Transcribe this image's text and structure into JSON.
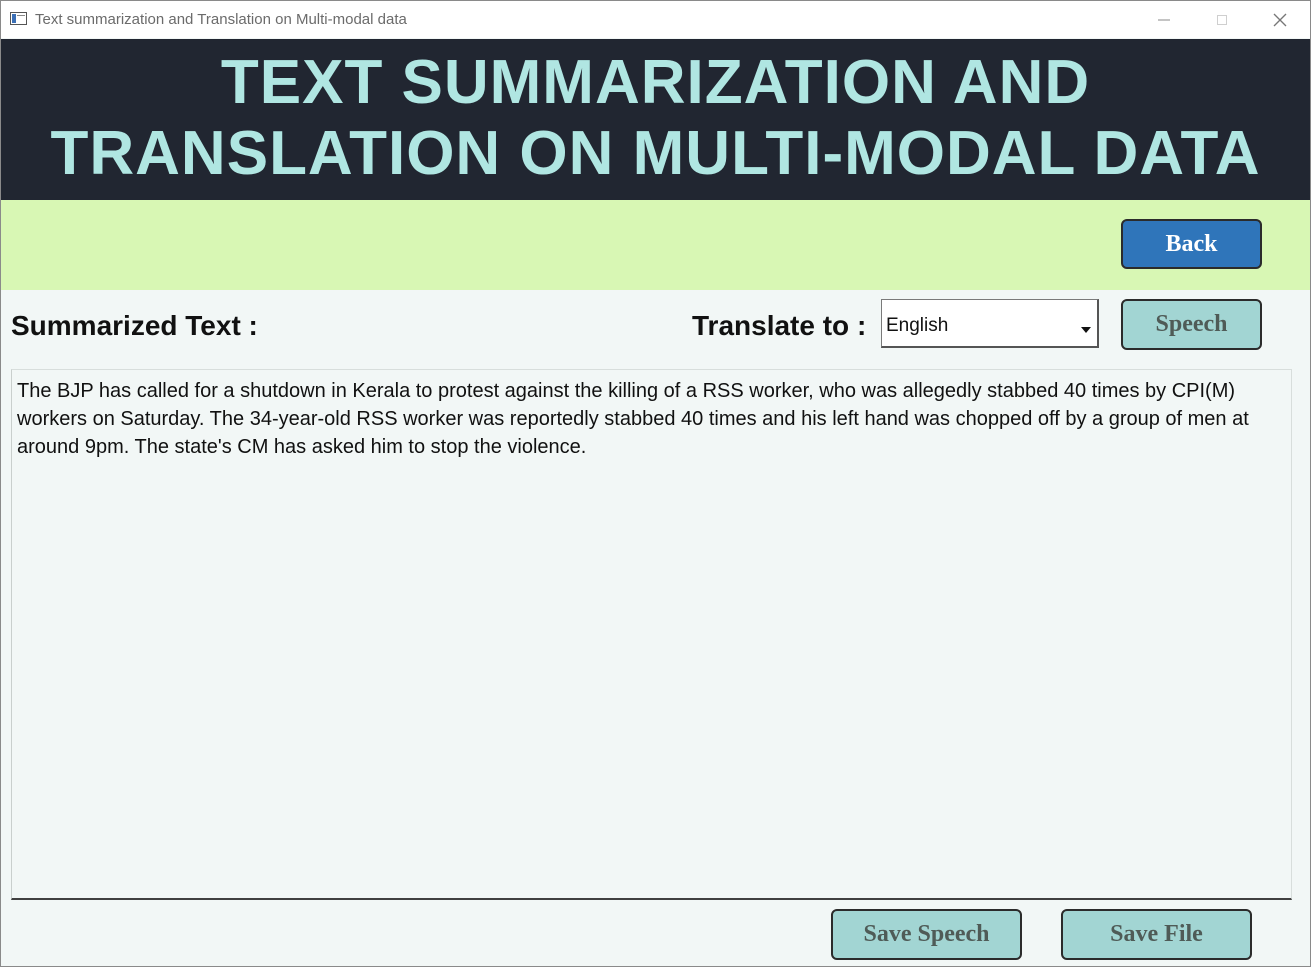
{
  "window": {
    "title": "Text summarization and Translation on Multi-modal data",
    "controls": [
      "minimize-icon",
      "maximize-icon",
      "close-icon"
    ]
  },
  "banner": {
    "line1": "TEXT SUMMARIZATION AND",
    "line2": "TRANSLATION ON MULTI-MODAL DATA"
  },
  "toolbar": {
    "back_label": "Back"
  },
  "main": {
    "summarized_label": "Summarized Text :",
    "translate_label": "Translate to :",
    "language_selected": "English",
    "speech_label": "Speech",
    "summary_text": "The BJP has called for a shutdown in Kerala to protest against the killing of a RSS worker, who was allegedly stabbed 40 times by CPI(M) workers on Saturday. The 34-year-old RSS worker was reportedly stabbed 40 times and his left hand was chopped off by a group of men at around 9pm. The state's CM has asked him to stop the violence."
  },
  "footer": {
    "save_speech_label": "Save Speech",
    "save_file_label": "Save File"
  },
  "colors": {
    "banner_bg": "#212631",
    "banner_text": "#b0e6e2",
    "toolbar_bg": "#d8f7b4",
    "back_button": "#2f75ba",
    "secondary_button": "#a2d5d3",
    "content_bg": "#f2f7f6"
  }
}
